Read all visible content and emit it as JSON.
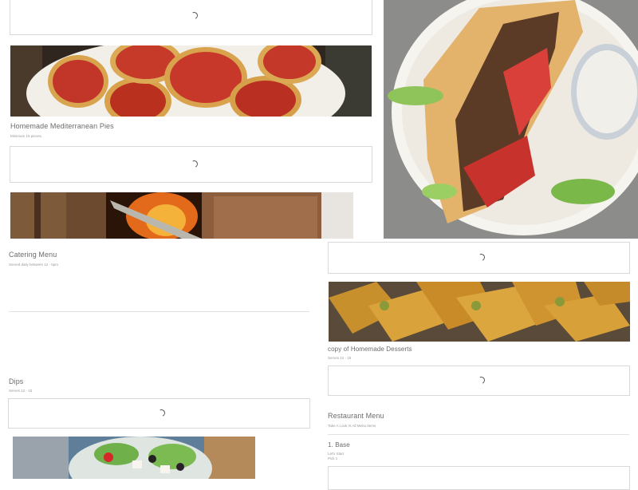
{
  "left": {
    "pies": {
      "title": "Homemade Mediterranean Pies",
      "note": "Minimum 15 pieces."
    },
    "catering": {
      "title": "Catering Menu",
      "note": "Served daily between 12 - 5pm"
    },
    "dips": {
      "title": "Dips",
      "note": "Serves 12 - 15"
    }
  },
  "right": {
    "desserts": {
      "title": "copy of Homemade Desserts",
      "note": "Serves 12 - 15"
    },
    "restaurant": {
      "title": "Restaurant Menu",
      "note": "Take A Look At All Menu Items"
    },
    "base": {
      "title": "1. Base",
      "note1": "Let's Start",
      "note2": "Pick 1"
    }
  },
  "images": {
    "pies": "meat-pies-photo",
    "shawarma": "shawarma-spit-photo",
    "gyro": "gyro-wrap-photo",
    "baklava": "baklava-photo",
    "salad": "greek-salad-photo"
  }
}
